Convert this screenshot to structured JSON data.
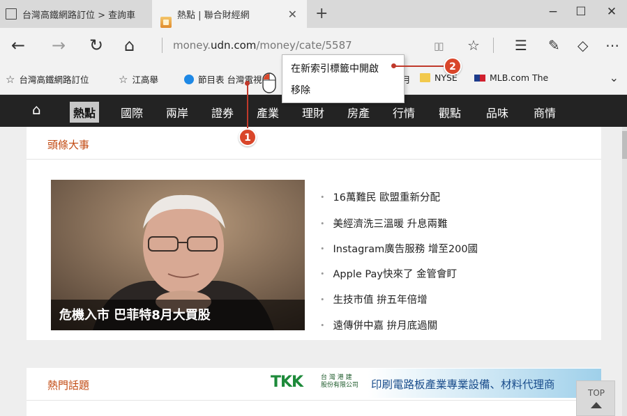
{
  "tabs": [
    {
      "title": "台灣高鐵網路訂位 > 查詢車",
      "icon": "page-icon"
    },
    {
      "title": "熱點 | 聯合財經網",
      "icon": "udn-favicon"
    }
  ],
  "window": {
    "new_tab": "+",
    "minimize": "−",
    "maximize": "☐",
    "close": "✕",
    "tab_close": "✕"
  },
  "address": {
    "prefix": "money.",
    "domain": "udn.com",
    "path": "/money/cate/5587"
  },
  "nav_glyphs": {
    "back": "←",
    "forward": "→",
    "refresh": "↻",
    "home": "⌂"
  },
  "toolbar_glyphs": {
    "reading": "▯▯",
    "favorite": "☆",
    "hub": "☰",
    "note": "✎",
    "share": "◇",
    "more": "⋯"
  },
  "favorites": [
    {
      "label": "台灣高鐵網路訂位",
      "icon": "star-icon"
    },
    {
      "label": "江高舉",
      "icon": "star-icon"
    },
    {
      "label": "節目表 台灣電視",
      "icon": "globe-icon"
    },
    {
      "label": "月",
      "icon": "none"
    },
    {
      "label": "NYSE",
      "icon": "folder-icon"
    },
    {
      "label": "MLB.com The",
      "icon": "mlb-icon"
    }
  ],
  "favorites_more": "⌄",
  "context_menu": {
    "items": [
      "在新索引標籤中開啟",
      "移除"
    ]
  },
  "callouts": [
    "1",
    "2"
  ],
  "site_nav": {
    "home_glyph": "⌂",
    "items": [
      "熱點",
      "國際",
      "兩岸",
      "證券",
      "產業",
      "理財",
      "房產",
      "行情",
      "觀點",
      "品味",
      "商情"
    ],
    "active_index": 0
  },
  "headline_section": {
    "title": "頭條大事",
    "photo_caption": "危機入市 巴菲特8月大買股",
    "bullet": "・",
    "headlines": [
      "16萬難民 歐盟重新分配",
      "美經濟洗三溫暖 升息兩難",
      "Instagram廣告服務 增至200國",
      "Apple Pay快來了 金管會盯",
      "生技市值 拚五年倍增",
      "遠傳併中嘉 拚月底過關"
    ]
  },
  "hot_section": {
    "title": "熱門話題"
  },
  "ad": {
    "logo": "TKK",
    "company_line1": "台 灣 港 建",
    "company_line2": "股份有限公司",
    "text": "印刷電路板產業專業設備、材料代理商"
  },
  "top_button": {
    "label": "TOP"
  },
  "colors": {
    "accent_orange": "#c24a12",
    "nav_bg": "#232323",
    "callout": "#d9462a"
  }
}
